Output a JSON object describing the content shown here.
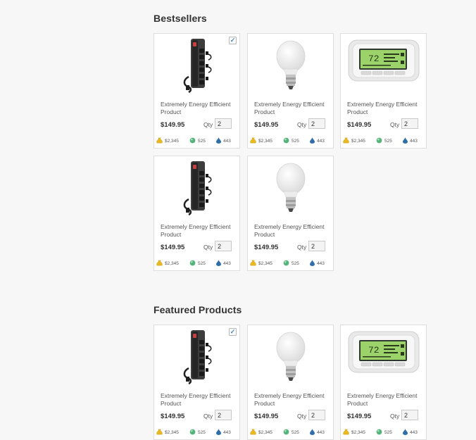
{
  "sections": [
    {
      "title": "Bestsellers",
      "products": [
        {
          "image": "power-strip",
          "checked": true,
          "name": "Extremely Energy Efficient Product",
          "price": "$149.95",
          "qty_label": "Qty",
          "qty": "2",
          "cost": "$2,345",
          "energy": "525",
          "water": "443"
        },
        {
          "image": "light-bulb",
          "checked": false,
          "name": "Extremely Energy Efficient Product",
          "price": "$149.95",
          "qty_label": "Qty",
          "qty": "2",
          "cost": "$2,345",
          "energy": "525",
          "water": "443"
        },
        {
          "image": "thermostat",
          "checked": false,
          "name": "Extremely Energy Efficient Product",
          "price": "$149.95",
          "qty_label": "Qty",
          "qty": "2",
          "cost": "$2,345",
          "energy": "525",
          "water": "443"
        },
        {
          "image": "power-strip",
          "checked": false,
          "name": "Extremely Energy Efficient Product",
          "price": "$149.95",
          "qty_label": "Qty",
          "qty": "2",
          "cost": "$2,345",
          "energy": "525",
          "water": "443"
        },
        {
          "image": "light-bulb",
          "checked": false,
          "name": "Extremely Energy Efficient Product",
          "price": "$149.95",
          "qty_label": "Qty",
          "qty": "2",
          "cost": "$2,345",
          "energy": "525",
          "water": "443"
        }
      ]
    },
    {
      "title": "Featured Products",
      "products": [
        {
          "image": "power-strip",
          "checked": true,
          "name": "Extremely Energy Efficient Product",
          "price": "$149.95",
          "qty_label": "Qty",
          "qty": "2",
          "cost": "$2,345",
          "energy": "525",
          "water": "443"
        },
        {
          "image": "light-bulb",
          "checked": false,
          "name": "Extremely Energy Efficient Product",
          "price": "$149.95",
          "qty_label": "Qty",
          "qty": "2",
          "cost": "$2,345",
          "energy": "525",
          "water": "443"
        },
        {
          "image": "thermostat",
          "checked": false,
          "name": "Extremely Energy Efficient Product",
          "price": "$149.95",
          "qty_label": "Qty",
          "qty": "2",
          "cost": "$2,345",
          "energy": "525",
          "water": "443"
        }
      ]
    }
  ],
  "icons": {
    "check": "✓",
    "cost": "money-bag-icon",
    "energy": "energy-orb-icon",
    "water": "water-drop-icon"
  },
  "thermostat_display": "72",
  "colors": {
    "check": "#4f87c7",
    "cost_icon": "#e8b923",
    "energy_icon": "#55b27a",
    "water_icon": "#2f6ea8",
    "thermostat_screen": "#9bd36a"
  }
}
